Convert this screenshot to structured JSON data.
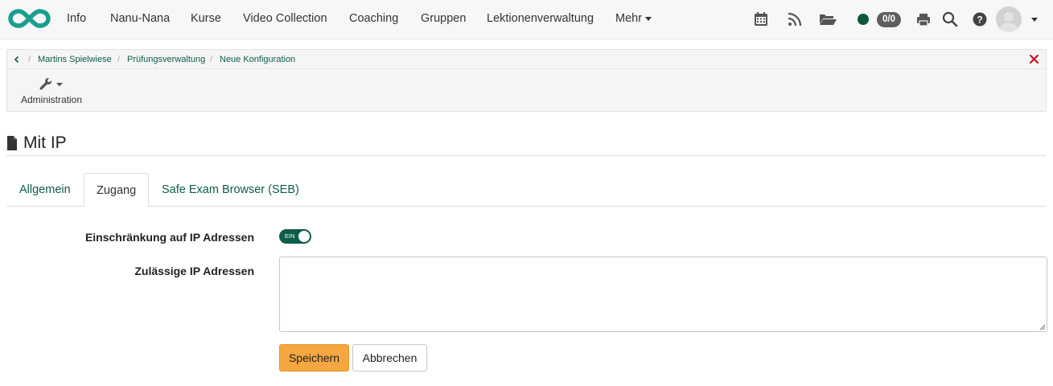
{
  "nav": {
    "items": [
      "Info",
      "Nanu-Nana",
      "Kurse",
      "Video Collection",
      "Coaching",
      "Gruppen",
      "Lektionenverwaltung",
      "Mehr"
    ],
    "count_badge": "0/0",
    "icons": [
      "calendar-icon",
      "rss-icon",
      "folder-open-icon",
      "printer-icon",
      "search-icon",
      "help-icon"
    ],
    "status_color": "#0a5a3a",
    "brand_color": "#1a9e8f"
  },
  "breadcrumb": {
    "items": [
      "Martins Spielwiese",
      "Prüfungsverwaltung",
      "Neue Konfiguration"
    ]
  },
  "toolbar": {
    "admin_label": "Administration"
  },
  "page": {
    "title": "Mit IP"
  },
  "tabs": {
    "items": [
      "Allgemein",
      "Zugang",
      "Safe Exam Browser (SEB)"
    ],
    "active": "Zugang"
  },
  "form": {
    "ip_restriction_label": "Einschränkung auf IP Adressen",
    "toggle_text": "EIN",
    "toggle_on": true,
    "allowed_ips_label": "Zulässige IP Adressen",
    "allowed_ips_value": "",
    "save_label": "Speichern",
    "cancel_label": "Abbrechen"
  }
}
